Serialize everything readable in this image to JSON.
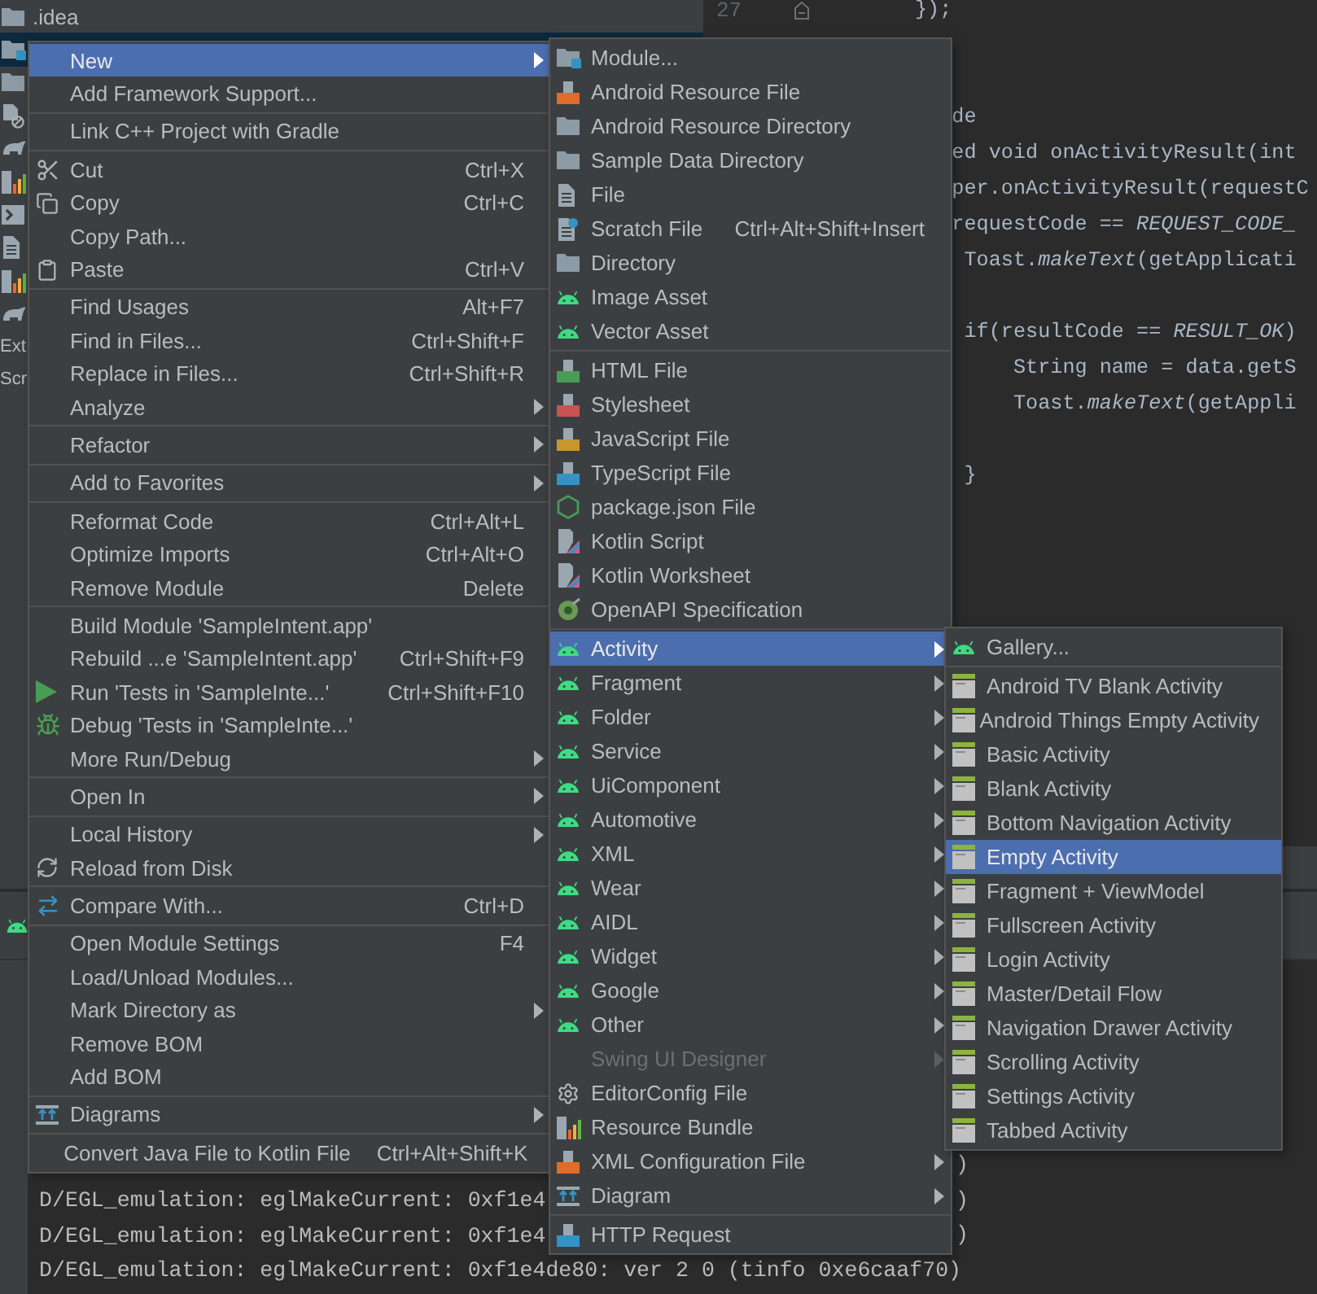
{
  "project_tree": [
    {
      "label": ".idea",
      "kind": "folder",
      "selected": false
    },
    {
      "kind": "module",
      "selected": true
    },
    {
      "kind": "folder",
      "selected": false
    },
    {
      "kind": "blocked-file",
      "selected": false
    },
    {
      "kind": "gradle",
      "selected": false
    },
    {
      "kind": "chart",
      "selected": false
    },
    {
      "kind": "terminal",
      "selected": false
    },
    {
      "kind": "file",
      "selected": false
    },
    {
      "kind": "chart",
      "selected": false
    },
    {
      "kind": "gradle",
      "selected": false
    },
    {
      "label": "Ext",
      "kind": "plain",
      "selected": false
    },
    {
      "label": "Scr",
      "kind": "plain",
      "selected": false
    }
  ],
  "editor": {
    "lines": [
      {
        "kind": "code",
        "number": "27",
        "text": "});"
      },
      {
        "kind": "blank"
      },
      {
        "kind": "blank"
      },
      {
        "kind": "code",
        "text": "   de"
      },
      {
        "kind": "code",
        "text": "   ed void onActivityResult(int"
      },
      {
        "kind": "code",
        "text": "   per.onActivityResult(requestC"
      },
      {
        "kind": "code",
        "text": "   requestCode == *REQUEST_CODE_*"
      },
      {
        "kind": "code",
        "text": "    Toast.*makeText*(getApplicati"
      },
      {
        "kind": "blank"
      },
      {
        "kind": "code",
        "text": "    if(resultCode == *RESULT_OK*)"
      },
      {
        "kind": "code",
        "text": "        String name = data.getS"
      },
      {
        "kind": "code",
        "text": "        Toast.*makeText*(getAppli"
      },
      {
        "kind": "blank"
      },
      {
        "kind": "code",
        "text": "    }"
      }
    ]
  },
  "log": {
    "lines": [
      {
        "tail": ")"
      },
      {
        "head": "D/EGL_emulation: eglMakeCurrent: 0xf1e4",
        "tail": ")"
      },
      {
        "head": "D/EGL_emulation: eglMakeCurrent: 0xf1e4",
        "tail": ")"
      },
      {
        "full": "D/EGL_emulation: eglMakeCurrent: 0xf1e4de80: ver 2 0 (tinfo 0xe6caaf70)"
      }
    ]
  },
  "menus": [
    {
      "groups": [
        [
          {
            "label": "New",
            "kind": "plain",
            "submenu": true,
            "selected": true
          },
          {
            "label": "Add Framework Support...",
            "kind": "plain",
            "submenu": false,
            "selected": false
          }
        ],
        [
          {
            "label": "Link C++ Project with Gradle",
            "kind": "plain",
            "submenu": false,
            "selected": false
          }
        ],
        [
          {
            "label": "Cut",
            "kind": "scissors",
            "shortcut": "Ctrl+X",
            "submenu": false,
            "selected": false
          },
          {
            "label": "Copy",
            "kind": "copy",
            "shortcut": "Ctrl+C",
            "submenu": false,
            "selected": false
          },
          {
            "label": "Copy Path...",
            "kind": "plain",
            "submenu": false,
            "selected": false
          },
          {
            "label": "Paste",
            "kind": "paste",
            "shortcut": "Ctrl+V",
            "submenu": false,
            "selected": false
          }
        ],
        [
          {
            "label": "Find Usages",
            "kind": "plain",
            "shortcut": "Alt+F7",
            "submenu": false,
            "selected": false
          },
          {
            "label": "Find in Files...",
            "kind": "plain",
            "shortcut": "Ctrl+Shift+F",
            "submenu": false,
            "selected": false
          },
          {
            "label": "Replace in Files...",
            "kind": "plain",
            "shortcut": "Ctrl+Shift+R",
            "submenu": false,
            "selected": false
          },
          {
            "label": "Analyze",
            "kind": "plain",
            "submenu": true,
            "selected": false
          }
        ],
        [
          {
            "label": "Refactor",
            "kind": "plain",
            "submenu": true,
            "selected": false
          }
        ],
        [
          {
            "label": "Add to Favorites",
            "kind": "plain",
            "submenu": true,
            "selected": false
          }
        ],
        [
          {
            "label": "Reformat Code",
            "kind": "plain",
            "shortcut": "Ctrl+Alt+L",
            "submenu": false,
            "selected": false
          },
          {
            "label": "Optimize Imports",
            "kind": "plain",
            "shortcut": "Ctrl+Alt+O",
            "submenu": false,
            "selected": false
          },
          {
            "label": "Remove Module",
            "kind": "plain",
            "shortcut": "Delete",
            "submenu": false,
            "selected": false
          }
        ],
        [
          {
            "label": "Build Module 'SampleIntent.app'",
            "kind": "plain",
            "submenu": false,
            "selected": false
          },
          {
            "label": "Rebuild ...e 'SampleIntent.app'",
            "kind": "plain",
            "shortcut": "Ctrl+Shift+F9",
            "submenu": false,
            "selected": false
          },
          {
            "label": "Run 'Tests in 'SampleInte...'",
            "kind": "run",
            "shortcut": "Ctrl+Shift+F10",
            "submenu": false,
            "selected": false
          },
          {
            "label": "Debug 'Tests in 'SampleInte...'",
            "kind": "debug",
            "submenu": false,
            "selected": false
          },
          {
            "label": "More Run/Debug",
            "kind": "plain",
            "submenu": true,
            "selected": false
          }
        ],
        [
          {
            "label": "Open In",
            "kind": "plain",
            "submenu": true,
            "selected": false
          }
        ],
        [
          {
            "label": "Local History",
            "kind": "plain",
            "submenu": true,
            "selected": false
          },
          {
            "label": "Reload from Disk",
            "kind": "reload",
            "submenu": false,
            "selected": false
          }
        ],
        [
          {
            "label": "Compare With...",
            "kind": "compare",
            "shortcut": "Ctrl+D",
            "submenu": false,
            "selected": false
          }
        ],
        [
          {
            "label": "Open Module Settings",
            "kind": "plain",
            "shortcut": "F4",
            "submenu": false,
            "selected": false
          },
          {
            "label": "Load/Unload Modules...",
            "kind": "plain",
            "submenu": false,
            "selected": false
          },
          {
            "label": "Mark Directory as",
            "kind": "plain",
            "submenu": true,
            "selected": false
          },
          {
            "label": "Remove BOM",
            "kind": "plain",
            "submenu": false,
            "selected": false
          },
          {
            "label": "Add BOM",
            "kind": "plain",
            "submenu": false,
            "selected": false
          }
        ],
        [
          {
            "label": "Diagrams",
            "kind": "diagram",
            "submenu": true,
            "selected": false
          }
        ],
        [
          {
            "label": "Convert Java File to Kotlin File",
            "kind": "plain",
            "shortcut": "Ctrl+Alt+Shift+K",
            "submenu": false,
            "selected": false
          }
        ]
      ]
    },
    {
      "groups": [
        [
          {
            "label": "Module...",
            "kind": "module",
            "submenu": false,
            "selected": false,
            "disabled": false
          },
          {
            "label": "Android Resource File",
            "kind": "xml",
            "submenu": false,
            "selected": false,
            "disabled": false
          },
          {
            "label": "Android Resource Directory",
            "kind": "folder",
            "submenu": false,
            "selected": false,
            "disabled": false
          },
          {
            "label": "Sample Data Directory",
            "kind": "folder",
            "submenu": false,
            "selected": false,
            "disabled": false
          },
          {
            "label": "File",
            "kind": "file",
            "submenu": false,
            "selected": false,
            "disabled": false
          },
          {
            "label": "Scratch File",
            "kind": "scratch",
            "shortcut": "Ctrl+Alt+Shift+Insert",
            "submenu": false,
            "selected": false,
            "disabled": false
          },
          {
            "label": "Directory",
            "kind": "folder",
            "submenu": false,
            "selected": false,
            "disabled": false
          },
          {
            "label": "Image Asset",
            "kind": "android",
            "submenu": false,
            "selected": false,
            "disabled": false
          },
          {
            "label": "Vector Asset",
            "kind": "android",
            "submenu": false,
            "selected": false,
            "disabled": false
          }
        ],
        [
          {
            "label": "HTML File",
            "kind": "html",
            "submenu": false,
            "selected": false,
            "disabled": false
          },
          {
            "label": "Stylesheet",
            "kind": "css",
            "submenu": false,
            "selected": false,
            "disabled": false
          },
          {
            "label": "JavaScript File",
            "kind": "js",
            "submenu": false,
            "selected": false,
            "disabled": false
          },
          {
            "label": "TypeScript File",
            "kind": "ts",
            "submenu": false,
            "selected": false,
            "disabled": false
          },
          {
            "label": "package.json File",
            "kind": "hexagon",
            "submenu": false,
            "selected": false,
            "disabled": false
          },
          {
            "label": "Kotlin Script",
            "kind": "kotlin",
            "submenu": false,
            "selected": false,
            "disabled": false
          },
          {
            "label": "Kotlin Worksheet",
            "kind": "kotlin",
            "submenu": false,
            "selected": false,
            "disabled": false
          },
          {
            "label": "OpenAPI Specification",
            "kind": "openapi",
            "submenu": false,
            "selected": false,
            "disabled": false
          }
        ],
        [
          {
            "label": "Activity",
            "kind": "android",
            "submenu": true,
            "selected": true,
            "disabled": false
          },
          {
            "label": "Fragment",
            "kind": "android",
            "submenu": true,
            "selected": false,
            "disabled": false
          },
          {
            "label": "Folder",
            "kind": "android",
            "submenu": true,
            "selected": false,
            "disabled": false
          },
          {
            "label": "Service",
            "kind": "android",
            "submenu": true,
            "selected": false,
            "disabled": false
          },
          {
            "label": "UiComponent",
            "kind": "android",
            "submenu": true,
            "selected": false,
            "disabled": false
          },
          {
            "label": "Automotive",
            "kind": "android",
            "submenu": true,
            "selected": false,
            "disabled": false
          },
          {
            "label": "XML",
            "kind": "android",
            "submenu": true,
            "selected": false,
            "disabled": false
          },
          {
            "label": "Wear",
            "kind": "android",
            "submenu": true,
            "selected": false,
            "disabled": false
          },
          {
            "label": "AIDL",
            "kind": "android",
            "submenu": true,
            "selected": false,
            "disabled": false
          },
          {
            "label": "Widget",
            "kind": "android",
            "submenu": true,
            "selected": false,
            "disabled": false
          },
          {
            "label": "Google",
            "kind": "android",
            "submenu": true,
            "selected": false,
            "disabled": false
          },
          {
            "label": "Other",
            "kind": "android",
            "submenu": true,
            "selected": false,
            "disabled": false
          },
          {
            "label": "Swing UI Designer",
            "kind": "plain",
            "submenu": true,
            "selected": false,
            "disabled": true
          },
          {
            "label": "EditorConfig File",
            "kind": "gear",
            "submenu": false,
            "selected": false,
            "disabled": false
          },
          {
            "label": "Resource Bundle",
            "kind": "chart",
            "submenu": false,
            "selected": false,
            "disabled": false
          },
          {
            "label": "XML Configuration File",
            "kind": "xml",
            "submenu": true,
            "selected": false,
            "disabled": false
          },
          {
            "label": "Diagram",
            "kind": "diagram",
            "submenu": true,
            "selected": false,
            "disabled": false
          }
        ],
        [
          {
            "label": "HTTP Request",
            "kind": "api",
            "submenu": false,
            "selected": false,
            "disabled": false
          }
        ]
      ]
    },
    {
      "groups": [
        [
          {
            "label": "Gallery...",
            "kind": "android",
            "submenu": false,
            "selected": false
          }
        ],
        [
          {
            "label": "Android TV Blank Activity",
            "kind": "template",
            "submenu": false,
            "selected": false
          },
          {
            "label": "Android Things Empty Activity",
            "kind": "template",
            "submenu": false,
            "selected": false
          },
          {
            "label": "Basic Activity",
            "kind": "template",
            "submenu": false,
            "selected": false
          },
          {
            "label": "Blank Activity",
            "kind": "template",
            "submenu": false,
            "selected": false
          },
          {
            "label": "Bottom Navigation Activity",
            "kind": "template",
            "submenu": false,
            "selected": false
          },
          {
            "label": "Empty Activity",
            "kind": "template",
            "submenu": false,
            "selected": true
          },
          {
            "label": "Fragment + ViewModel",
            "kind": "template",
            "submenu": false,
            "selected": false
          },
          {
            "label": "Fullscreen Activity",
            "kind": "template",
            "submenu": false,
            "selected": false
          },
          {
            "label": "Login Activity",
            "kind": "template",
            "submenu": false,
            "selected": false
          },
          {
            "label": "Master/Detail Flow",
            "kind": "template",
            "submenu": false,
            "selected": false
          },
          {
            "label": "Navigation Drawer Activity",
            "kind": "template",
            "submenu": false,
            "selected": false
          },
          {
            "label": "Scrolling Activity",
            "kind": "template",
            "submenu": false,
            "selected": false
          },
          {
            "label": "Settings Activity",
            "kind": "template",
            "submenu": false,
            "selected": false
          },
          {
            "label": "Tabbed Activity",
            "kind": "template",
            "submenu": false,
            "selected": false
          }
        ]
      ]
    }
  ]
}
